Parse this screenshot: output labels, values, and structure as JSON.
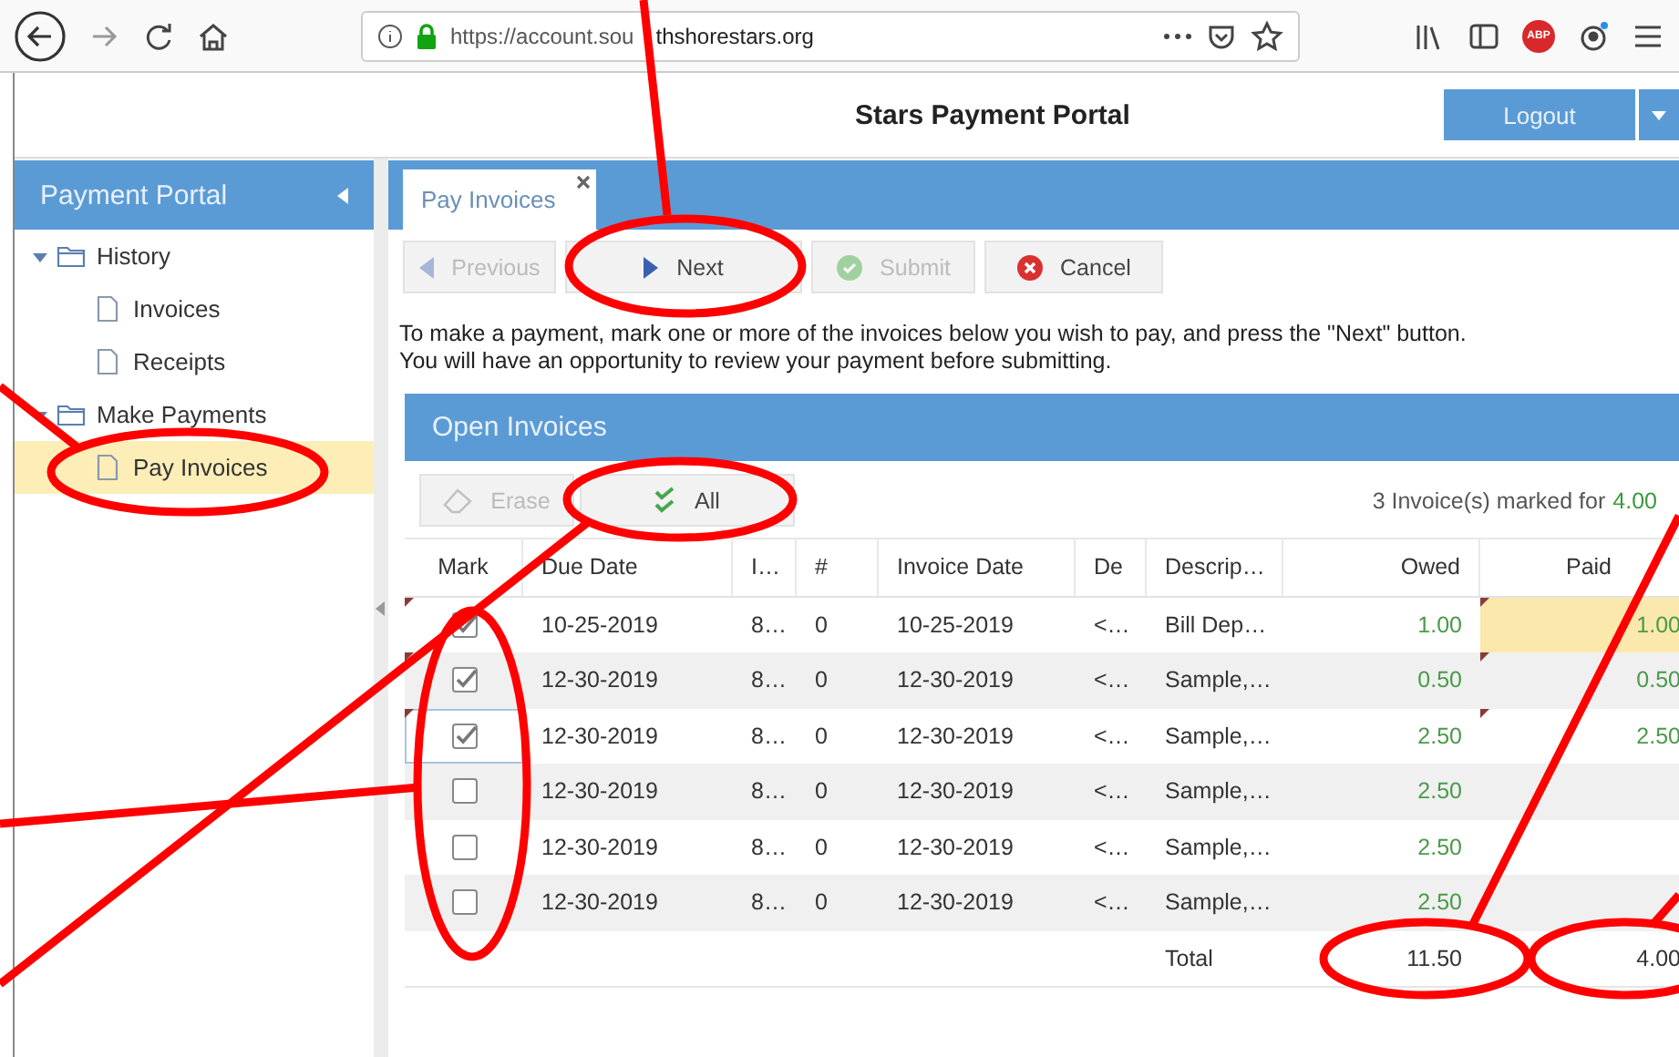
{
  "browser": {
    "url_parts": [
      "https://account.sou",
      "thshorestars.org"
    ],
    "adblock_label": "ABP"
  },
  "app": {
    "title": "Stars Payment Portal",
    "logout": "Logout"
  },
  "sidebar": {
    "title": "Payment Portal",
    "tree": [
      {
        "label": "History",
        "expanded": true,
        "selected": false,
        "children": [
          {
            "label": "Invoices",
            "selected": false
          },
          {
            "label": "Receipts",
            "selected": false
          }
        ]
      },
      {
        "label": "Make Payments",
        "expanded": true,
        "selected": false,
        "children": [
          {
            "label": "Pay Invoices",
            "selected": true
          }
        ]
      }
    ]
  },
  "tabs": [
    {
      "label": "Pay Invoices",
      "selected": true
    }
  ],
  "toolbar": [
    {
      "kind": "previous",
      "label": "Previous",
      "disabled": true
    },
    {
      "kind": "next",
      "label": "Next",
      "disabled": false
    },
    {
      "kind": "submit",
      "label": "Submit",
      "disabled": true
    },
    {
      "kind": "cancel",
      "label": "Cancel",
      "disabled": false
    }
  ],
  "instructions": [
    "To make a payment, mark one or more of the invoices below you wish to pay, and press the \"Next\" button.",
    "You will have an opportunity to review your payment before submitting."
  ],
  "invoices": {
    "title": "Open Invoices",
    "actions": [
      {
        "kind": "erase",
        "label": "Erase",
        "disabled": true
      },
      {
        "kind": "all",
        "label": "All",
        "disabled": false
      }
    ],
    "summary_text": "3 Invoice(s) marked for",
    "summary_amount": "4.00",
    "columns": [
      "Mark",
      "Due Date",
      "I…",
      "#",
      "Invoice Date",
      "De",
      "Descrip…",
      "Owed",
      "Paid"
    ],
    "rows": [
      {
        "checked": true,
        "due_date": "10-25-2019",
        "column_3": "8…",
        "number": "0",
        "invoice_date": "10-25-2019",
        "column_6": "<…",
        "description": "Bill Dep…",
        "owed": "1.00",
        "paid": "1.00",
        "editing": true
      },
      {
        "checked": true,
        "due_date": "12-30-2019",
        "column_3": "8…",
        "number": "0",
        "invoice_date": "12-30-2019",
        "column_6": "<…",
        "description": "Sample,…",
        "owed": "0.50",
        "paid": "0.50",
        "editing": false
      },
      {
        "checked": true,
        "due_date": "12-30-2019",
        "column_3": "8…",
        "number": "0",
        "invoice_date": "12-30-2019",
        "column_6": "<…",
        "description": "Sample,…",
        "owed": "2.50",
        "paid": "2.50",
        "editing": false
      },
      {
        "checked": false,
        "due_date": "12-30-2019",
        "column_3": "8…",
        "number": "0",
        "invoice_date": "12-30-2019",
        "column_6": "<…",
        "description": "Sample,…",
        "owed": "2.50",
        "editing": false
      },
      {
        "checked": false,
        "due_date": "12-30-2019",
        "column_3": "8…",
        "number": "0",
        "invoice_date": "12-30-2019",
        "column_6": "<…",
        "description": "Sample,…",
        "owed": "2.50",
        "editing": false
      },
      {
        "checked": false,
        "due_date": "12-30-2019",
        "column_3": "8…",
        "number": "0",
        "invoice_date": "12-30-2019",
        "column_6": "<…",
        "description": "Sample,…",
        "owed": "2.50",
        "editing": false
      }
    ],
    "total": {
      "label": "Total",
      "owed": "11.50",
      "paid": "4.00"
    }
  }
}
